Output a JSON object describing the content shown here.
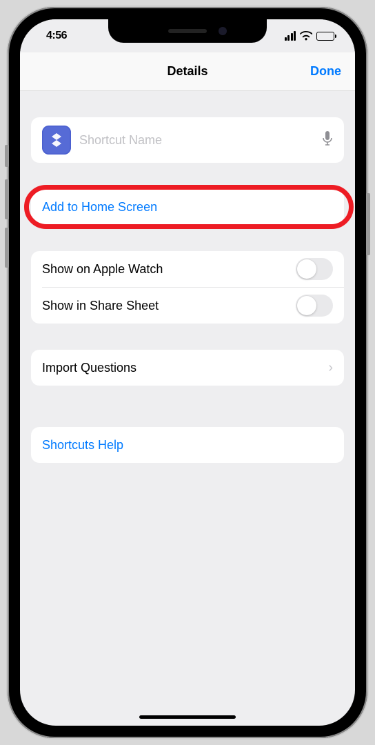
{
  "status": {
    "time": "4:56"
  },
  "nav": {
    "title": "Details",
    "done": "Done"
  },
  "shortcut": {
    "name_placeholder": "Shortcut Name",
    "name_value": ""
  },
  "actions": {
    "add_to_home": "Add to Home Screen",
    "show_watch": "Show on Apple Watch",
    "show_share": "Show in Share Sheet",
    "import_questions": "Import Questions",
    "help": "Shortcuts Help"
  },
  "toggles": {
    "show_watch": false,
    "show_share": false
  }
}
